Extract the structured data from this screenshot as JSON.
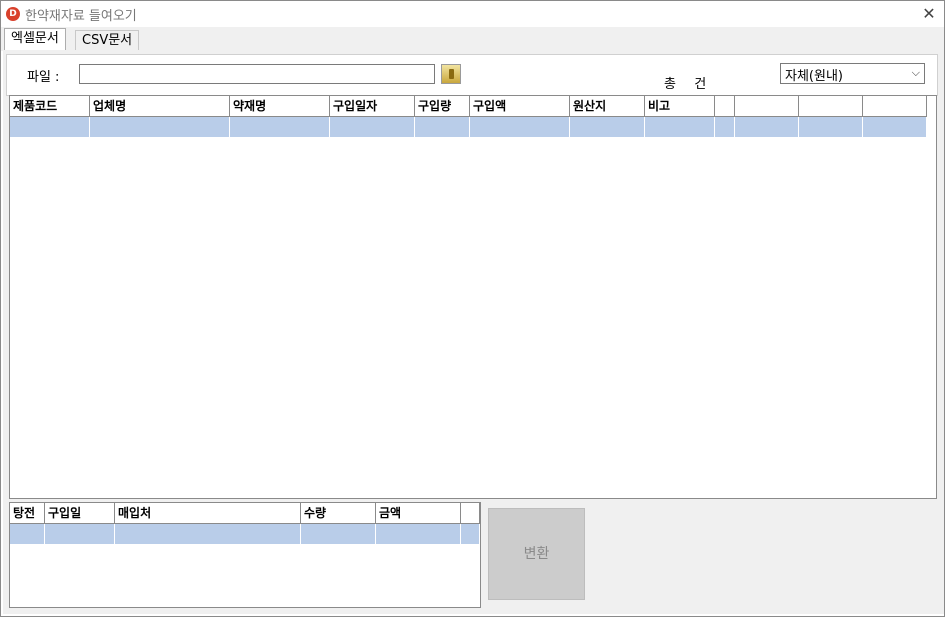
{
  "window": {
    "title": "한약재자료 들여오기",
    "app_icon_letter": "D",
    "close_symbol": "✕"
  },
  "tabs": [
    {
      "label": "엑셀문서",
      "active": true
    },
    {
      "label": "CSV문서",
      "active": false
    }
  ],
  "file": {
    "label": "파일 :",
    "value": "",
    "browse_icon": "folder-icon"
  },
  "total": {
    "prefix": "총",
    "count": "",
    "suffix": "건"
  },
  "source_select": {
    "selected": "자체(원내)"
  },
  "main_grid": {
    "columns": [
      "제품코드",
      "업체명",
      "약재명",
      "구입일자",
      "구입량",
      "구입액",
      "원산지",
      "비고",
      "",
      "",
      "",
      ""
    ],
    "rows": [
      [
        "",
        "",
        "",
        "",
        "",
        "",
        "",
        "",
        "",
        "",
        "",
        ""
      ]
    ]
  },
  "sub_grid": {
    "columns": [
      "탕전",
      "구입일",
      "매입처",
      "수량",
      "금액",
      ""
    ],
    "rows": [
      [
        "",
        "",
        "",
        "",
        "",
        ""
      ]
    ]
  },
  "convert_button": {
    "label": "변환"
  },
  "colors": {
    "selected_row": "#b9cde9",
    "grid_border": "#8a8a8a",
    "panel_bg": "#f0f0f0",
    "disabled_button": "#cccccc"
  }
}
